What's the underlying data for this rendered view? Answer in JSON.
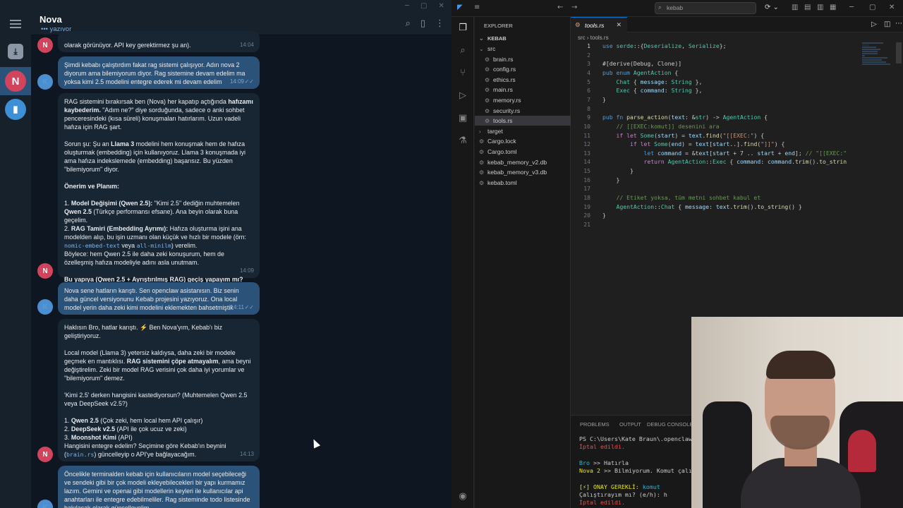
{
  "telegram": {
    "chat_title": "Nova",
    "status": "yazıyor",
    "rail": [
      {
        "initial": "N",
        "color": "#d1445b"
      }
    ],
    "messages": [
      {
        "avatar": "N",
        "text": "olarak görünüyor. API key gerektirmez şu an).",
        "time": "14:04"
      },
      {
        "avatar": "K",
        "text": "Şimdi kebabı çalıştırdım fakat rag sistemi çalışıyor. Adın nova 2 diyorum ama bilemiyorum diyor. Rag sistemine devam edelim ma yoksa kimi 2.5 modelini entegre ederek mi devam edelim",
        "time": "14:09"
      },
      {
        "avatar": "N",
        "time": "14:09",
        "p1": "RAG sistemini bırakırsak ben (Nova) her kapatıp açtığında ",
        "p1b": "hafızamı kaybederim.",
        "p1c": " \"Adım ne?\" diye sorduğunda, sadece o anki sohbet penceresindeki (kısa süreli) konuşmaları hatırlarım. Uzun vadeli hafıza için RAG şart.",
        "p2": "Sorun şu: Şu an ",
        "p2b": "Llama 3",
        "p2c": " modelini hem konuşmak hem de hafıza oluşturmak (embedding) için kullanıyoruz. Llama 3 konuşmada iyi ama hafıza indekslemede (embedding) başarısız. Bu yüzden \"bilemiyorum\" diyor.",
        "p3": "Önerim ve Planım:",
        "l1a": "1. ",
        "l1b": "Model Değişimi (Qwen 2.5):",
        "l1c": " \"Kimi 2.5\" dediğin muhtemelen ",
        "l1d": "Qwen 2.5",
        "l1e": " (Türkçe performansı efsane). Ana beyin olarak buna geçelim.",
        "l2a": "2. ",
        "l2b": "RAG Tamiri (Embedding Ayrımı):",
        "l2c": " Hafıza oluşturma işini ana modelden alıp, bu işin uzmanı olan küçük ve hızlı bir modele (örn: ",
        "l2code1": "nomic-embed-text",
        "l2d": " veya ",
        "l2code2": "all-minilm",
        "l2e": ") verelim.",
        "l3": "Böylece: hem Qwen 2.5 ile daha zeki konuşurum, hem de özelleşmiş hafıza modeliyle adını asla unutmam.",
        "p4": "Bu yapıya (Qwen 2.5 + Ayrıştırılmış RAG) geçiş yapayım mı?"
      },
      {
        "avatar": "K",
        "text": "Nova sene hatların karıştı. Sen openclaw asistanısın. Biz senin daha güncel versiyonunu Kebab projesini yazıyoruz. Ona local model yerin daha zeki kimi modelini eklemekten bahsetmiştik",
        "time": "14:11"
      },
      {
        "avatar": "N",
        "time": "14:13",
        "a1": "Haklısın Bro, hatlar karıştı. ⚡ Ben Nova'yım, Kebab'ı biz geliştiriyoruz.",
        "a2a": "Local model (Llama 3) yetersiz kaldıysa, daha zeki bir modele geçmek en mantıklısı. ",
        "a2b": "RAG sistemini çöpe atmayalım",
        "a2c": ", ama beyni değiştirelim. Zeki bir model RAG verisini çok daha iyi yorumlar ve \"bilemiyorum\" demez.",
        "a3": "'Kimi 2.5' derken hangisini kastediyorsun? (Muhtemelen Qwen 2.5 veya DeepSeek v2.5?)",
        "o1a": "1. ",
        "o1b": "Qwen 2.5",
        "o1c": " (Çok zeki, hem local hem API çalışır)",
        "o2a": "2. ",
        "o2b": "DeepSeek v2.5",
        "o2c": " (API ile çok ucuz ve zeki)",
        "o3a": "3. ",
        "o3b": "Moonshot Kimi",
        "o3c": " (API)",
        "a4": "Hangisini entegre edelim? Seçimine göre Kebab'ın beynini (",
        "a4code": "brain.rs",
        "a4b": ") güncelleyip o API'ye bağlayacağım."
      },
      {
        "avatar": "K",
        "text": "Öncelikle terminalden kebab için kullanıcıların model seçebileceği ve sendeki gibi bir çok modeli ekleyebilecekleri bir yapı kurmamız lazım. Gemini ve openai gibi modellerin keyleri ile kullanıcılar api anahtarları ile entegre edebilmeliler. Rag sisteminde todo listesinde bakılacak olarak güncelleyelim.",
        "time": ""
      }
    ]
  },
  "vscode": {
    "search_text": "kebab",
    "explorer_label": "EXPLORER",
    "project": "KEBAB",
    "tree": [
      {
        "label": "src",
        "type": "folder-open",
        "indent": 1
      },
      {
        "label": "brain.rs",
        "type": "file",
        "indent": 2
      },
      {
        "label": "config.rs",
        "type": "file",
        "indent": 2
      },
      {
        "label": "ethics.rs",
        "type": "file",
        "indent": 2
      },
      {
        "label": "main.rs",
        "type": "file",
        "indent": 2
      },
      {
        "label": "memory.rs",
        "type": "file",
        "indent": 2
      },
      {
        "label": "security.rs",
        "type": "file",
        "indent": 2
      },
      {
        "label": "tools.rs",
        "type": "file",
        "indent": 2,
        "selected": true
      },
      {
        "label": "target",
        "type": "folder",
        "indent": 1
      },
      {
        "label": "Cargo.lock",
        "type": "file",
        "indent": 1
      },
      {
        "label": "Cargo.toml",
        "type": "file",
        "indent": 1
      },
      {
        "label": "kebab_memory_v2.db",
        "type": "file",
        "indent": 1
      },
      {
        "label": "kebab_memory_v3.db",
        "type": "file",
        "indent": 1
      },
      {
        "label": "kebab.toml",
        "type": "file",
        "indent": 1
      }
    ],
    "active_tab": "tools.rs",
    "breadcrumb": [
      "src",
      "tools.rs"
    ],
    "code": [
      [
        [
          "k",
          "use "
        ],
        [
          "t",
          "serde"
        ],
        [
          "",
          "::{"
        ],
        [
          "t",
          "Deserialize"
        ],
        [
          "",
          ", "
        ],
        [
          "t",
          "Serialize"
        ],
        [
          "",
          "};"
        ]
      ],
      [],
      [
        [
          "",
          "#[derive(Debug, Clone)]"
        ]
      ],
      [
        [
          "k",
          "pub enum "
        ],
        [
          "t",
          "AgentAction"
        ],
        [
          "",
          " {"
        ]
      ],
      [
        [
          "",
          "    "
        ],
        [
          "t",
          "Chat"
        ],
        [
          "",
          " { "
        ],
        [
          "v",
          "message"
        ],
        [
          "",
          ": "
        ],
        [
          "t",
          "String"
        ],
        [
          "",
          " },"
        ]
      ],
      [
        [
          "",
          "    "
        ],
        [
          "t",
          "Exec"
        ],
        [
          "",
          " { "
        ],
        [
          "v",
          "command"
        ],
        [
          "",
          ": "
        ],
        [
          "t",
          "String"
        ],
        [
          "",
          " },"
        ]
      ],
      [
        [
          "",
          "}"
        ]
      ],
      [],
      [
        [
          "k",
          "pub fn "
        ],
        [
          "f",
          "parse_action"
        ],
        [
          "",
          "("
        ],
        [
          "v",
          "text"
        ],
        [
          "",
          ": &"
        ],
        [
          "t",
          "str"
        ],
        [
          "",
          ") -> "
        ],
        [
          "t",
          "AgentAction"
        ],
        [
          "",
          " {"
        ]
      ],
      [
        [
          "c",
          "    // [[EXEC:komut]] desenini ara"
        ]
      ],
      [
        [
          "",
          "    "
        ],
        [
          "kw",
          "if let "
        ],
        [
          "t",
          "Some"
        ],
        [
          "",
          "("
        ],
        [
          "v",
          "start"
        ],
        [
          "",
          ") = "
        ],
        [
          "v",
          "text"
        ],
        [
          "",
          "."
        ],
        [
          "f",
          "find"
        ],
        [
          "",
          "("
        ],
        [
          "s",
          "\"[[EXEC:\""
        ],
        [
          "",
          ") {"
        ]
      ],
      [
        [
          "",
          "        "
        ],
        [
          "kw",
          "if let "
        ],
        [
          "t",
          "Some"
        ],
        [
          "",
          "("
        ],
        [
          "v",
          "end"
        ],
        [
          "",
          ") = "
        ],
        [
          "v",
          "text"
        ],
        [
          "",
          "["
        ],
        [
          "v",
          "start"
        ],
        [
          "",
          "..]."
        ],
        [
          "f",
          "find"
        ],
        [
          "",
          "("
        ],
        [
          "s",
          "\"]]\""
        ],
        [
          "",
          ") {"
        ]
      ],
      [
        [
          "",
          "            "
        ],
        [
          "k",
          "let "
        ],
        [
          "v",
          "command"
        ],
        [
          "",
          " = &"
        ],
        [
          "v",
          "text"
        ],
        [
          "",
          "["
        ],
        [
          "v",
          "start"
        ],
        [
          "",
          " + 7 .. "
        ],
        [
          "v",
          "start"
        ],
        [
          "",
          " + "
        ],
        [
          "v",
          "end"
        ],
        [
          "",
          "]; "
        ],
        [
          "c",
          "// \"[[EXEC:\""
        ]
      ],
      [
        [
          "",
          "            "
        ],
        [
          "kw",
          "return "
        ],
        [
          "t",
          "AgentAction"
        ],
        [
          "",
          "::"
        ],
        [
          "t",
          "Exec"
        ],
        [
          "",
          " { "
        ],
        [
          "v",
          "command"
        ],
        [
          "",
          ": "
        ],
        [
          "v",
          "command"
        ],
        [
          "",
          "."
        ],
        [
          "f",
          "trim"
        ],
        [
          "",
          "()."
        ],
        [
          "f",
          "to_strin"
        ]
      ],
      [
        [
          "",
          "        }"
        ]
      ],
      [
        [
          "",
          "    }"
        ]
      ],
      [],
      [
        [
          "c",
          "    // Etiket yoksa, tüm metni sohbet kabul et"
        ]
      ],
      [
        [
          "",
          "    "
        ],
        [
          "t",
          "AgentAction"
        ],
        [
          "",
          "::"
        ],
        [
          "t",
          "Chat"
        ],
        [
          "",
          " { "
        ],
        [
          "v",
          "message"
        ],
        [
          "",
          ": "
        ],
        [
          "v",
          "text"
        ],
        [
          "",
          "."
        ],
        [
          "f",
          "trim"
        ],
        [
          "",
          "()."
        ],
        [
          "f",
          "to_string"
        ],
        [
          "",
          "() }"
        ]
      ],
      [
        [
          "",
          "}"
        ]
      ],
      []
    ],
    "panel_tabs": [
      "PROBLEMS",
      "OUTPUT",
      "DEBUG CONSOLE"
    ],
    "terminal": {
      "prompt": "PS C:\\Users\\Kate Braun\\.openclaw\\w",
      "cancelled1": "İptal edildi.",
      "bro_label": "Bro",
      "bro_text": " >> Hatırla",
      "nova_label": "Nova 2",
      "nova_text": " >> Bilmiyorum. Komut çalışt",
      "approval": "[⚡] ONAY GEREKLİ:",
      "approval_cmd": " komut",
      "ask": "Çalıştırayım mı? (e/h): h",
      "cancelled2": "İptal edildi."
    }
  }
}
